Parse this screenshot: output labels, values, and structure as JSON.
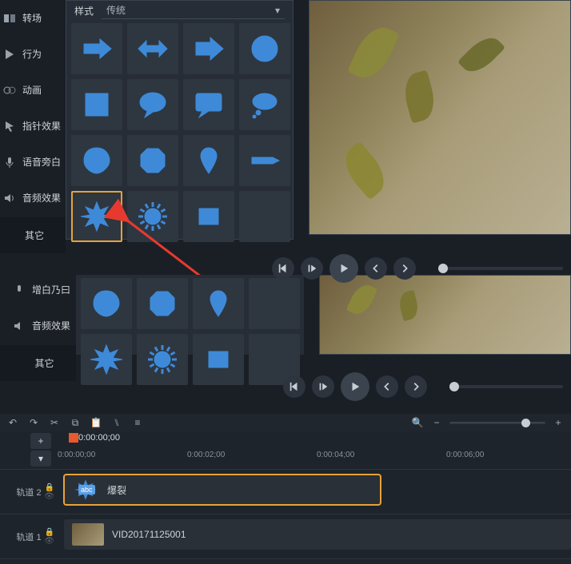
{
  "sidebar": {
    "items": [
      {
        "label": "转场",
        "icon": "transition-icon"
      },
      {
        "label": "行为",
        "icon": "behavior-icon"
      },
      {
        "label": "动画",
        "icon": "animation-icon"
      },
      {
        "label": "指针效果",
        "icon": "pointer-icon"
      },
      {
        "label": "语音旁白",
        "icon": "mic-icon"
      },
      {
        "label": "音频效果",
        "icon": "audio-icon"
      }
    ],
    "other": "其它"
  },
  "sidebar2": {
    "items": [
      {
        "label": "增白乃曰",
        "icon": "mic-icon"
      },
      {
        "label": "音频效果",
        "icon": "audio-icon"
      }
    ],
    "other": "其它"
  },
  "picker": {
    "style_label": "样式",
    "style_value": "传统",
    "shapes": [
      "arrow-right",
      "arrow-lr",
      "arrow-right-solid",
      "circle",
      "square",
      "speech-oval",
      "speech-rect",
      "thought-cloud",
      "blob",
      "octagon",
      "pin",
      "pointer-shape",
      "burst",
      "sun",
      "rect-small",
      "blank"
    ],
    "selected_index": 12
  },
  "picker2": {
    "shapes": [
      "blob",
      "octagon",
      "pin",
      "blank",
      "burst",
      "sun",
      "rect-small",
      "blank"
    ]
  },
  "transport": {
    "buttons": [
      "prev",
      "step-fwd",
      "play",
      "back",
      "forward"
    ]
  },
  "toolbar": {
    "icons": [
      "undo",
      "redo",
      "cut",
      "copy",
      "paste",
      "split",
      "props"
    ],
    "zoom": {
      "search": "search-icon",
      "minus": "−",
      "plus": "+"
    }
  },
  "timeline": {
    "timecode": "0:00:00;00",
    "ticks": [
      "0:00:00;00",
      "0:00:02;00",
      "0:00:04;00",
      "0:00:06;00"
    ],
    "tracks": [
      {
        "name": "轨道 2",
        "clip_label": "爆裂",
        "clip_tag": "abc"
      },
      {
        "name": "轨道 1",
        "clip_label": "VID20171125001"
      }
    ]
  }
}
